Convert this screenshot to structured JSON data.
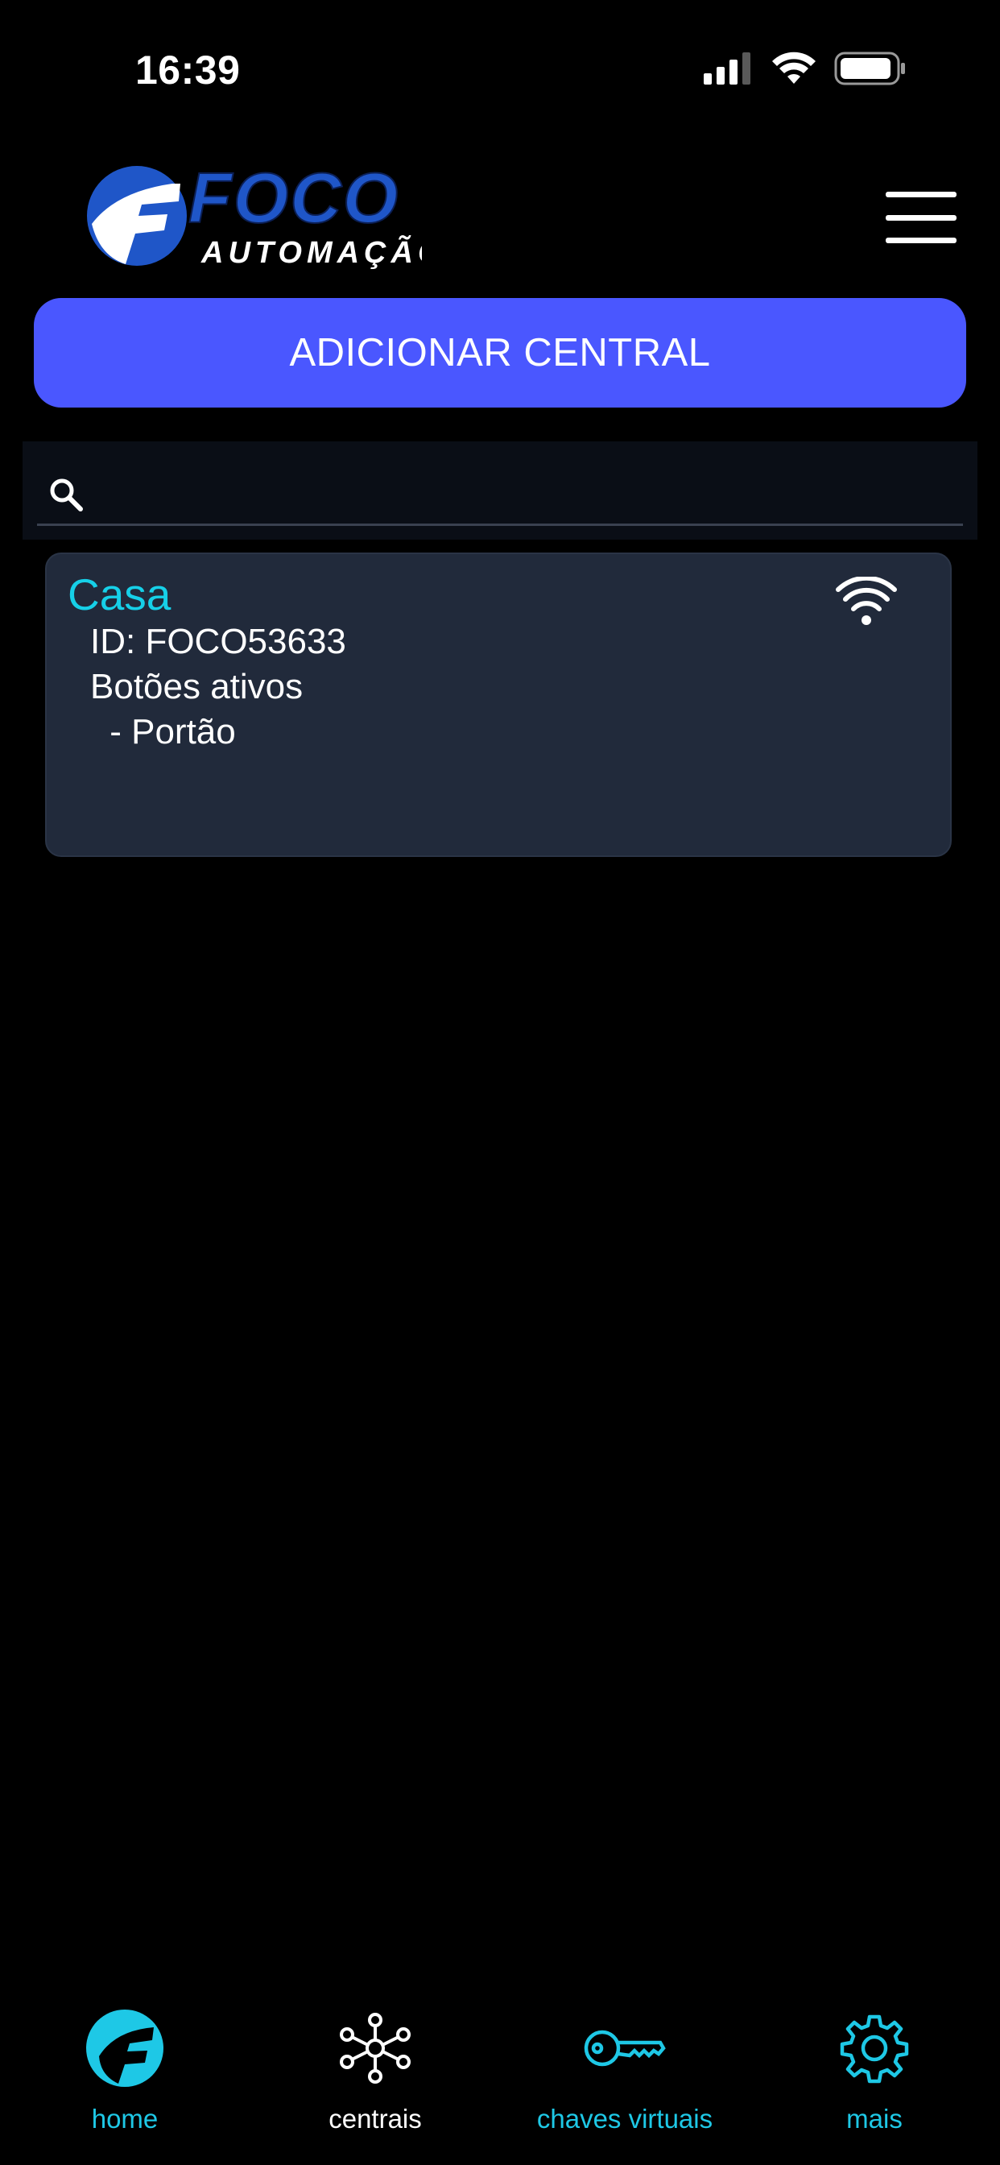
{
  "status_bar": {
    "time": "16:39"
  },
  "header": {
    "logo_text": "FOCO",
    "logo_subtext": "AUTOMAÇÃO",
    "menu_icon": "hamburger-menu-icon"
  },
  "actions": {
    "add_central_label": "ADICIONAR CENTRAL"
  },
  "search": {
    "value": "",
    "placeholder": ""
  },
  "centrals": [
    {
      "name": "Casa",
      "id_line": "ID: FOCO53633",
      "buttons_heading": "Botões ativos",
      "buttons": [
        " - Portão"
      ],
      "connection_icon": "wifi-icon"
    }
  ],
  "bottom_nav": {
    "items": [
      {
        "label": "home",
        "icon": "foco-f-icon",
        "color": "#1ec8e6"
      },
      {
        "label": "centrais",
        "icon": "network-hub-icon",
        "color": "#ffffff"
      },
      {
        "label": "chaves virtuais",
        "icon": "key-icon",
        "color": "#1ec8e6"
      },
      {
        "label": "mais",
        "icon": "gear-icon",
        "color": "#1ec8e6"
      }
    ]
  },
  "colors": {
    "background": "#000000",
    "primary_button": "#4a57ff",
    "card_background": "#212a3b",
    "accent_cyan": "#16d0e8",
    "logo_blue": "#1f56c8"
  }
}
